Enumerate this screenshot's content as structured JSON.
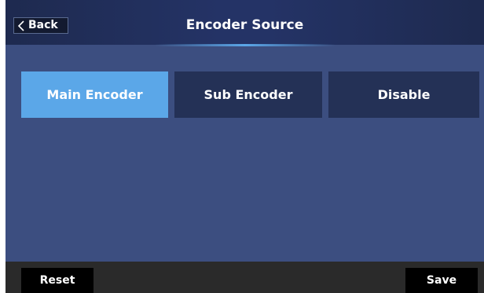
{
  "header": {
    "back_label": "Back",
    "title": "Encoder Source"
  },
  "tabs": [
    {
      "label": "Main Encoder",
      "selected": true
    },
    {
      "label": "Sub Encoder",
      "selected": false
    },
    {
      "label": "Disable",
      "selected": false
    }
  ],
  "footer": {
    "reset_label": "Reset",
    "save_label": "Save"
  },
  "colors": {
    "panel_bg": "#3c4e80",
    "header_bg": "#243366",
    "selected_tab": "#5ba7e8",
    "unselected_tab": "#243156",
    "footer_bg": "#2a2a2a"
  },
  "icons": {
    "back": "chevron-left-icon"
  }
}
